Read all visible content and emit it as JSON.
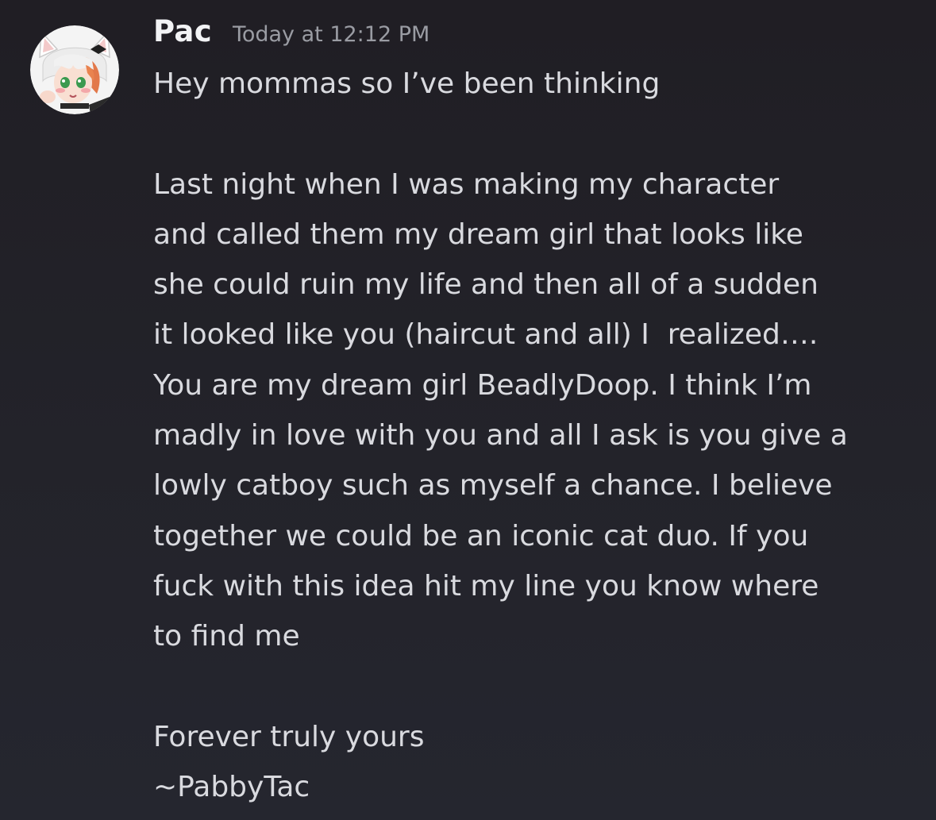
{
  "message": {
    "author": "Pac",
    "timestamp": "Today at 12:12 PM",
    "avatar_icon": "catboy-avatar",
    "lines": [
      "Hey mommas so I’ve been thinking",
      "",
      "Last night when I was making my character",
      "and called them my dream girl that looks like",
      "she could ruin my life and then all of a sudden",
      "it looked like you (haircut and all) I  realized….",
      "You are my dream girl BeadlyDoop. I think I’m",
      "madly in love with you and all I ask is you give a",
      "lowly catboy such as myself a chance. I believe",
      "together we could be an iconic cat duo. If you",
      "fuck with this idea hit my line you know where",
      "to find me",
      "",
      "Forever truly yours",
      "~PabbyTac"
    ]
  },
  "colors": {
    "background": "#23232a",
    "username": "#f2f3f5",
    "timestamp": "#9a9ca3",
    "text": "#d9dadf"
  }
}
